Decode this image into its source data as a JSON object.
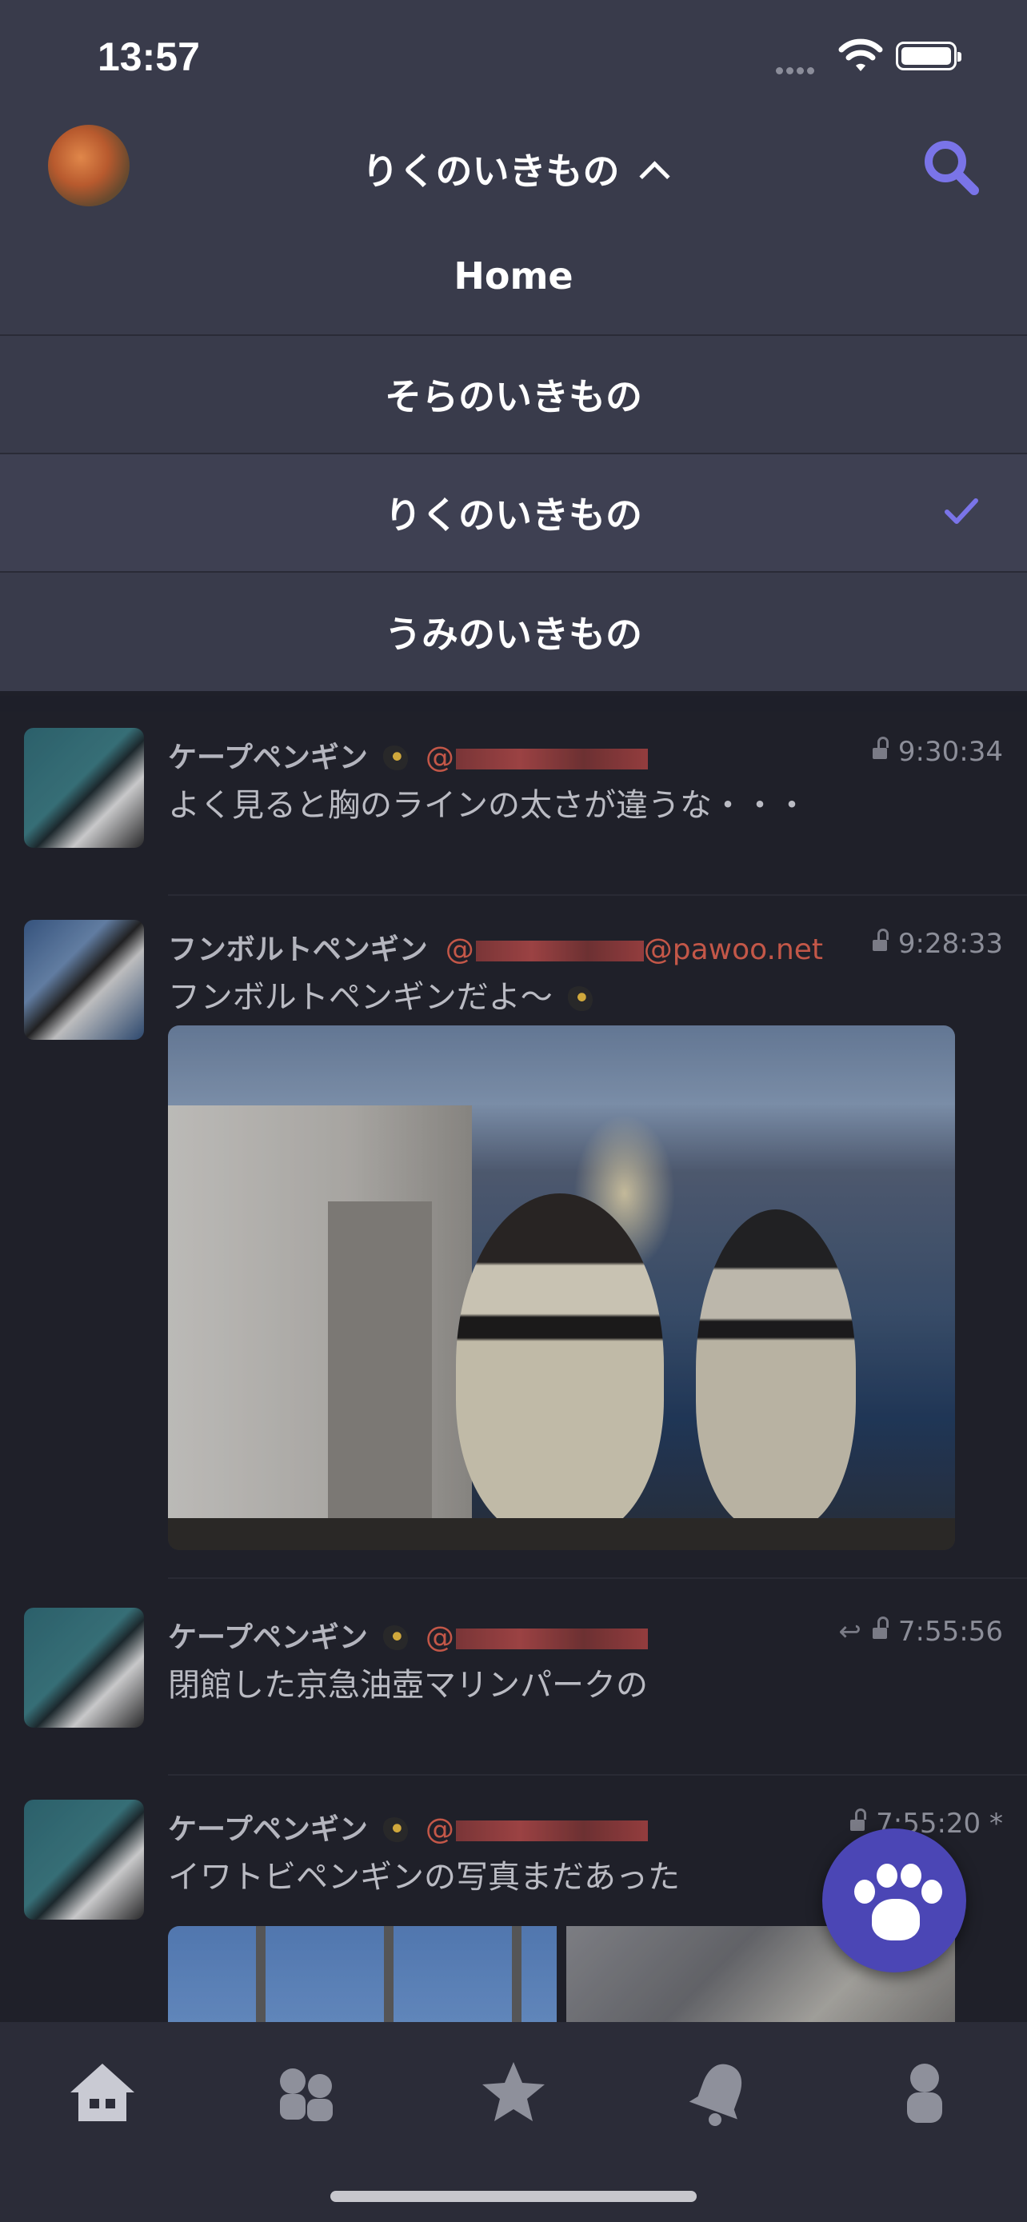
{
  "status_bar": {
    "time": "13:57"
  },
  "nav": {
    "title": "りくのいきもの",
    "icons": {
      "search": "search-icon",
      "dropdown": "chevron-up-icon"
    }
  },
  "menu": {
    "items": [
      {
        "label": "Home",
        "selected": false
      },
      {
        "label": "そらのいきもの",
        "selected": false
      },
      {
        "label": "りくのいきもの",
        "selected": true
      },
      {
        "label": "うみのいきもの",
        "selected": false
      }
    ]
  },
  "posts": [
    {
      "name": "ケープペンギン",
      "acct_prefix": "@",
      "acct_suffix": "",
      "time": "9:30:34",
      "text": "よく見ると胸のラインの太さが違うな・・・"
    },
    {
      "name": "フンボルトペンギン",
      "acct_prefix": "@",
      "acct_suffix": "@pawoo.net",
      "time": "9:28:33",
      "text": "フンボルトペンギンだよ〜"
    },
    {
      "name": "ケープペンギン",
      "acct_prefix": "@",
      "acct_suffix": "",
      "time": "7:55:56",
      "text": "閉館した京急油壺マリンパークの"
    },
    {
      "name": "ケープペンギン",
      "acct_prefix": "@",
      "acct_suffix": "",
      "time": "7:55:20 *",
      "text": "イワトビペンギンの写真まだあった"
    }
  ],
  "tabs": [
    {
      "icon": "home-icon"
    },
    {
      "icon": "people-icon"
    },
    {
      "icon": "star-icon"
    },
    {
      "icon": "bell-icon"
    },
    {
      "icon": "person-icon"
    }
  ],
  "colors": {
    "accent": "#7a74e8",
    "mention": "#e0614e",
    "fab": "#4b46b5"
  }
}
